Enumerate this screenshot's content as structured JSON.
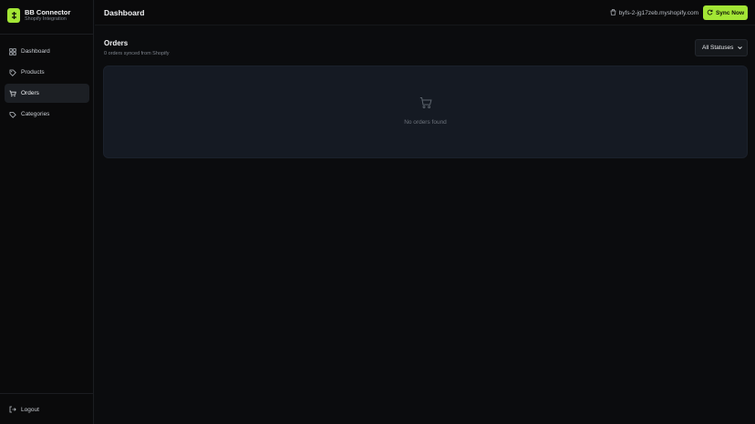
{
  "brand": {
    "name": "BB Connector",
    "subtitle": "Shopify Integration"
  },
  "sidebar": {
    "items": [
      {
        "label": "Dashboard",
        "icon": "dashboard-icon",
        "active": false
      },
      {
        "label": "Products",
        "icon": "tag-icon",
        "active": false
      },
      {
        "label": "Orders",
        "icon": "cart-icon",
        "active": true
      },
      {
        "label": "Categories",
        "icon": "bookmark-icon",
        "active": false
      }
    ],
    "logout_label": "Logout"
  },
  "header": {
    "title": "Dashboard",
    "store_url": "byfs-2-jg17zeb.myshopify.com",
    "sync_label": "Sync Now"
  },
  "orders": {
    "title": "Orders",
    "subtitle": "0 orders synced from Shopify",
    "filter_value": "All Statuses",
    "empty_text": "No orders found"
  },
  "colors": {
    "accent": "#a3e635",
    "background": "#0b0c0e",
    "panel": "#151a23",
    "active_nav": "#1c1f24"
  }
}
